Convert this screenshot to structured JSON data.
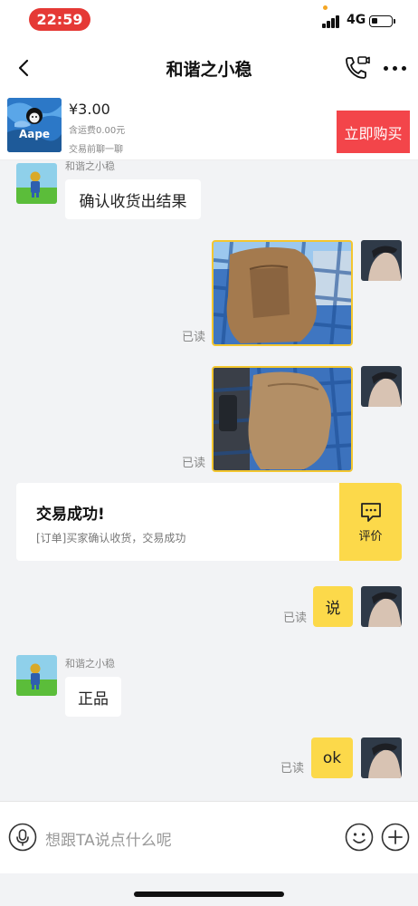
{
  "status_bar": {
    "time": "22:59",
    "network": "4G"
  },
  "header": {
    "title": "和谐之小稳"
  },
  "product": {
    "thumb_brand": "Aape",
    "price": "¥3.00",
    "shipping": "含运费0.00元",
    "hint": "交易前聊一聊",
    "buy_label": "立即购买",
    "buy_color": "#f3454a"
  },
  "messages": {
    "m1": {
      "sender": "和谐之小稳",
      "text": "确认收货出结果"
    },
    "photo1": {
      "status": "已读"
    },
    "photo2": {
      "status": "已读"
    },
    "order_card": {
      "title": "交易成功!",
      "subtitle": "[订单]买家确认收货，交易成功",
      "action_label": "评价"
    },
    "m2": {
      "text": "说",
      "status": "已读"
    },
    "m3": {
      "sender": "和谐之小稳",
      "text": "正品"
    },
    "m4": {
      "text": "ok",
      "status": "已读"
    }
  },
  "input": {
    "placeholder": "想跟TA说点什么呢"
  },
  "colors": {
    "accent_yellow": "#fcd94a",
    "time_pill": "#e53935"
  },
  "icons": [
    "back-arrow-icon",
    "phone-call-icon",
    "more-dots-icon",
    "microphone-icon",
    "emoji-icon",
    "plus-icon",
    "comment-icon"
  ]
}
